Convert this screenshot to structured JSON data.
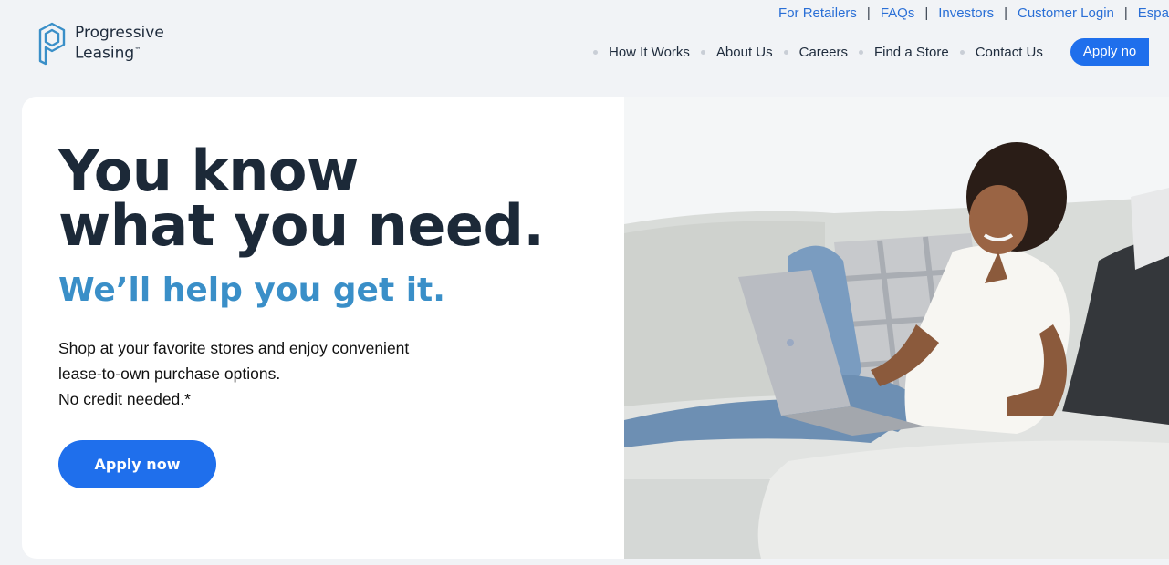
{
  "brand": {
    "name_line1": "Progressive",
    "name_line2": "Leasing",
    "trademark": "™",
    "color": "#1e2b3c"
  },
  "utility_nav": [
    "For Retailers",
    "FAQs",
    "Investors",
    "Customer Login",
    "Espa"
  ],
  "main_nav": {
    "items": [
      "How It Works",
      "About Us",
      "Careers",
      "Find a Store",
      "Contact Us"
    ],
    "apply_label": "Apply no"
  },
  "hero": {
    "headline_line1": "You know",
    "headline_line2": "what you need.",
    "subhead": "We’ll help you get it.",
    "body_line1": "Shop at your favorite stores and enjoy convenient",
    "body_line2": "lease-to-own purchase options.",
    "body_line3": "No credit needed.*",
    "cta_label": "Apply now"
  },
  "colors": {
    "accent": "#1f6fec",
    "link": "#2a6fd6",
    "subhead": "#3a8fc8",
    "headline": "#1c2938"
  }
}
